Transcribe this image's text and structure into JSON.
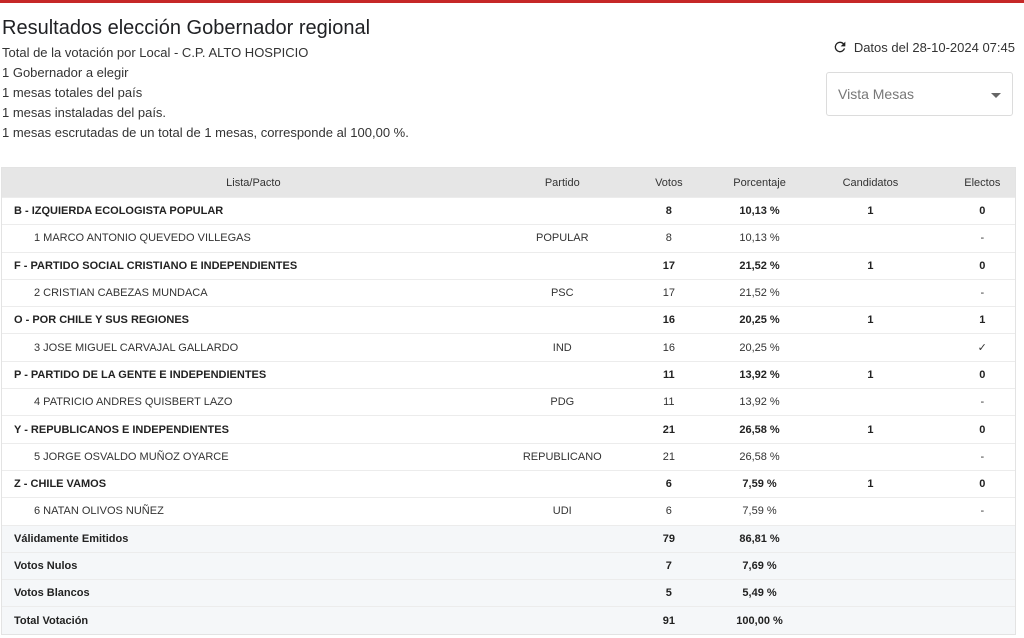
{
  "header": {
    "title": "Resultados elección Gobernador regional",
    "lines": [
      "Total de la votación por Local - C.P. ALTO HOSPICIO",
      "1 Gobernador a elegir",
      "1 mesas totales del país",
      "1 mesas instaladas del país.",
      "1 mesas escrutadas de un total de 1 mesas, corresponde al 100,00 %."
    ],
    "datos": "Datos del 28-10-2024 07:45",
    "view_select": "Vista Mesas"
  },
  "table": {
    "columns": [
      "Lista/Pacto",
      "Partido",
      "Votos",
      "Porcentaje",
      "Candidatos",
      "Electos"
    ],
    "rows": [
      {
        "type": "pacto",
        "name": "B - IZQUIERDA ECOLOGISTA POPULAR",
        "partido": "",
        "votos": "8",
        "pct": "10,13 %",
        "cand": "1",
        "electos": "0"
      },
      {
        "type": "cand",
        "name": "1 MARCO ANTONIO QUEVEDO VILLEGAS",
        "partido": "POPULAR",
        "votos": "8",
        "pct": "10,13 %",
        "cand": "",
        "electos": "-"
      },
      {
        "type": "pacto",
        "name": "F - PARTIDO SOCIAL CRISTIANO E INDEPENDIENTES",
        "partido": "",
        "votos": "17",
        "pct": "21,52 %",
        "cand": "1",
        "electos": "0"
      },
      {
        "type": "cand",
        "name": "2 CRISTIAN CABEZAS MUNDACA",
        "partido": "PSC",
        "votos": "17",
        "pct": "21,52 %",
        "cand": "",
        "electos": "-"
      },
      {
        "type": "pacto",
        "name": "O - POR CHILE Y SUS REGIONES",
        "partido": "",
        "votos": "16",
        "pct": "20,25 %",
        "cand": "1",
        "electos": "1"
      },
      {
        "type": "cand",
        "name": "3 JOSE MIGUEL CARVAJAL GALLARDO",
        "partido": "IND",
        "votos": "16",
        "pct": "20,25 %",
        "cand": "",
        "electos": "✓"
      },
      {
        "type": "pacto",
        "name": "P - PARTIDO DE LA GENTE E INDEPENDIENTES",
        "partido": "",
        "votos": "11",
        "pct": "13,92 %",
        "cand": "1",
        "electos": "0"
      },
      {
        "type": "cand",
        "name": "4 PATRICIO ANDRES QUISBERT LAZO",
        "partido": "PDG",
        "votos": "11",
        "pct": "13,92 %",
        "cand": "",
        "electos": "-"
      },
      {
        "type": "pacto",
        "name": "Y - REPUBLICANOS E INDEPENDIENTES",
        "partido": "",
        "votos": "21",
        "pct": "26,58 %",
        "cand": "1",
        "electos": "0"
      },
      {
        "type": "cand",
        "name": "5 JORGE OSVALDO MUÑOZ OYARCE",
        "partido": "REPUBLICANO",
        "votos": "21",
        "pct": "26,58 %",
        "cand": "",
        "electos": "-"
      },
      {
        "type": "pacto",
        "name": "Z - CHILE VAMOS",
        "partido": "",
        "votos": "6",
        "pct": "7,59 %",
        "cand": "1",
        "electos": "0"
      },
      {
        "type": "cand",
        "name": "6 NATAN OLIVOS NUÑEZ",
        "partido": "UDI",
        "votos": "6",
        "pct": "7,59 %",
        "cand": "",
        "electos": "-"
      },
      {
        "type": "tot",
        "name": "Válidamente Emitidos",
        "partido": "",
        "votos": "79",
        "pct": "86,81 %",
        "cand": "",
        "electos": ""
      },
      {
        "type": "tot",
        "name": "Votos Nulos",
        "partido": "",
        "votos": "7",
        "pct": "7,69 %",
        "cand": "",
        "electos": ""
      },
      {
        "type": "tot",
        "name": "Votos Blancos",
        "partido": "",
        "votos": "5",
        "pct": "5,49 %",
        "cand": "",
        "electos": ""
      },
      {
        "type": "tot",
        "name": "Total Votación",
        "partido": "",
        "votos": "91",
        "pct": "100,00 %",
        "cand": "",
        "electos": ""
      }
    ]
  }
}
